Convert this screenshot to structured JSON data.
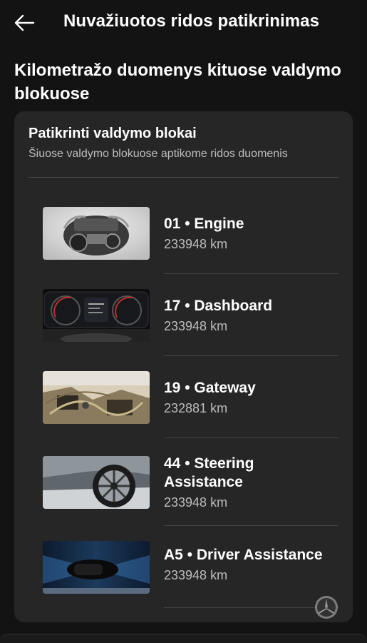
{
  "header": {
    "title": "Nuvažiuotos ridos patikrinimas"
  },
  "section": {
    "title": "Kilometražo duomenys kituose valdymo blokuose"
  },
  "card": {
    "title": "Patikrinti valdymo blokai",
    "subtitle": "Šiuose valdymo blokuose aptikome ridos duomenis"
  },
  "modules": [
    {
      "name": "01 • Engine",
      "mileage": "233948 km",
      "image": "engine-photo"
    },
    {
      "name": "17 • Dashboard",
      "mileage": "233948 km",
      "image": "dashboard-photo"
    },
    {
      "name": "19 • Gateway",
      "mileage": "232881 km",
      "image": "gateway-wiring-photo"
    },
    {
      "name": "44 • Steering Assistance",
      "mileage": "233948 km",
      "image": "wheel-photo"
    },
    {
      "name": "A5 • Driver Assistance",
      "mileage": "233948 km",
      "image": "driver-assist-photo"
    }
  ],
  "icons": {
    "back": "arrow-left-icon",
    "brand": "mercedes-star-icon"
  },
  "colors": {
    "background": "#131313",
    "card": "#262626",
    "text": "#ffffff",
    "muted": "#bdbdbd"
  }
}
